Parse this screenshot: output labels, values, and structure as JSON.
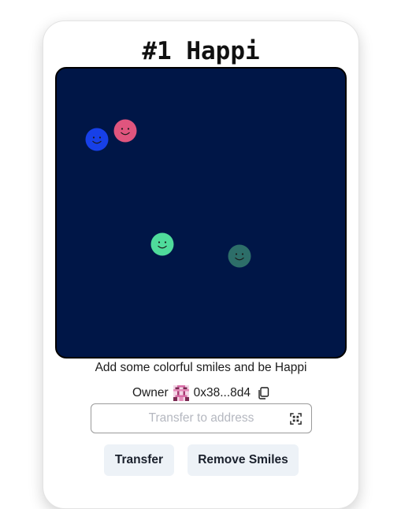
{
  "nft": {
    "title": "#1 Happi",
    "description": "Add some colorful smiles and be Happi"
  },
  "canvas": {
    "background": "#001647",
    "smiles": [
      {
        "color": "#1740e8"
      },
      {
        "color": "#e0557e"
      },
      {
        "color": "#4fdb9b"
      },
      {
        "color": "#2d6e69"
      }
    ]
  },
  "owner": {
    "label": "Owner",
    "address": "0x38...8d4",
    "avatar_icon": "blockie-avatar",
    "copy_icon": "copy-icon"
  },
  "transfer": {
    "placeholder": "Transfer to address",
    "scan_icon": "qr-scan-icon"
  },
  "buttons": {
    "transfer_label": "Transfer",
    "remove_label": "Remove Smiles"
  }
}
